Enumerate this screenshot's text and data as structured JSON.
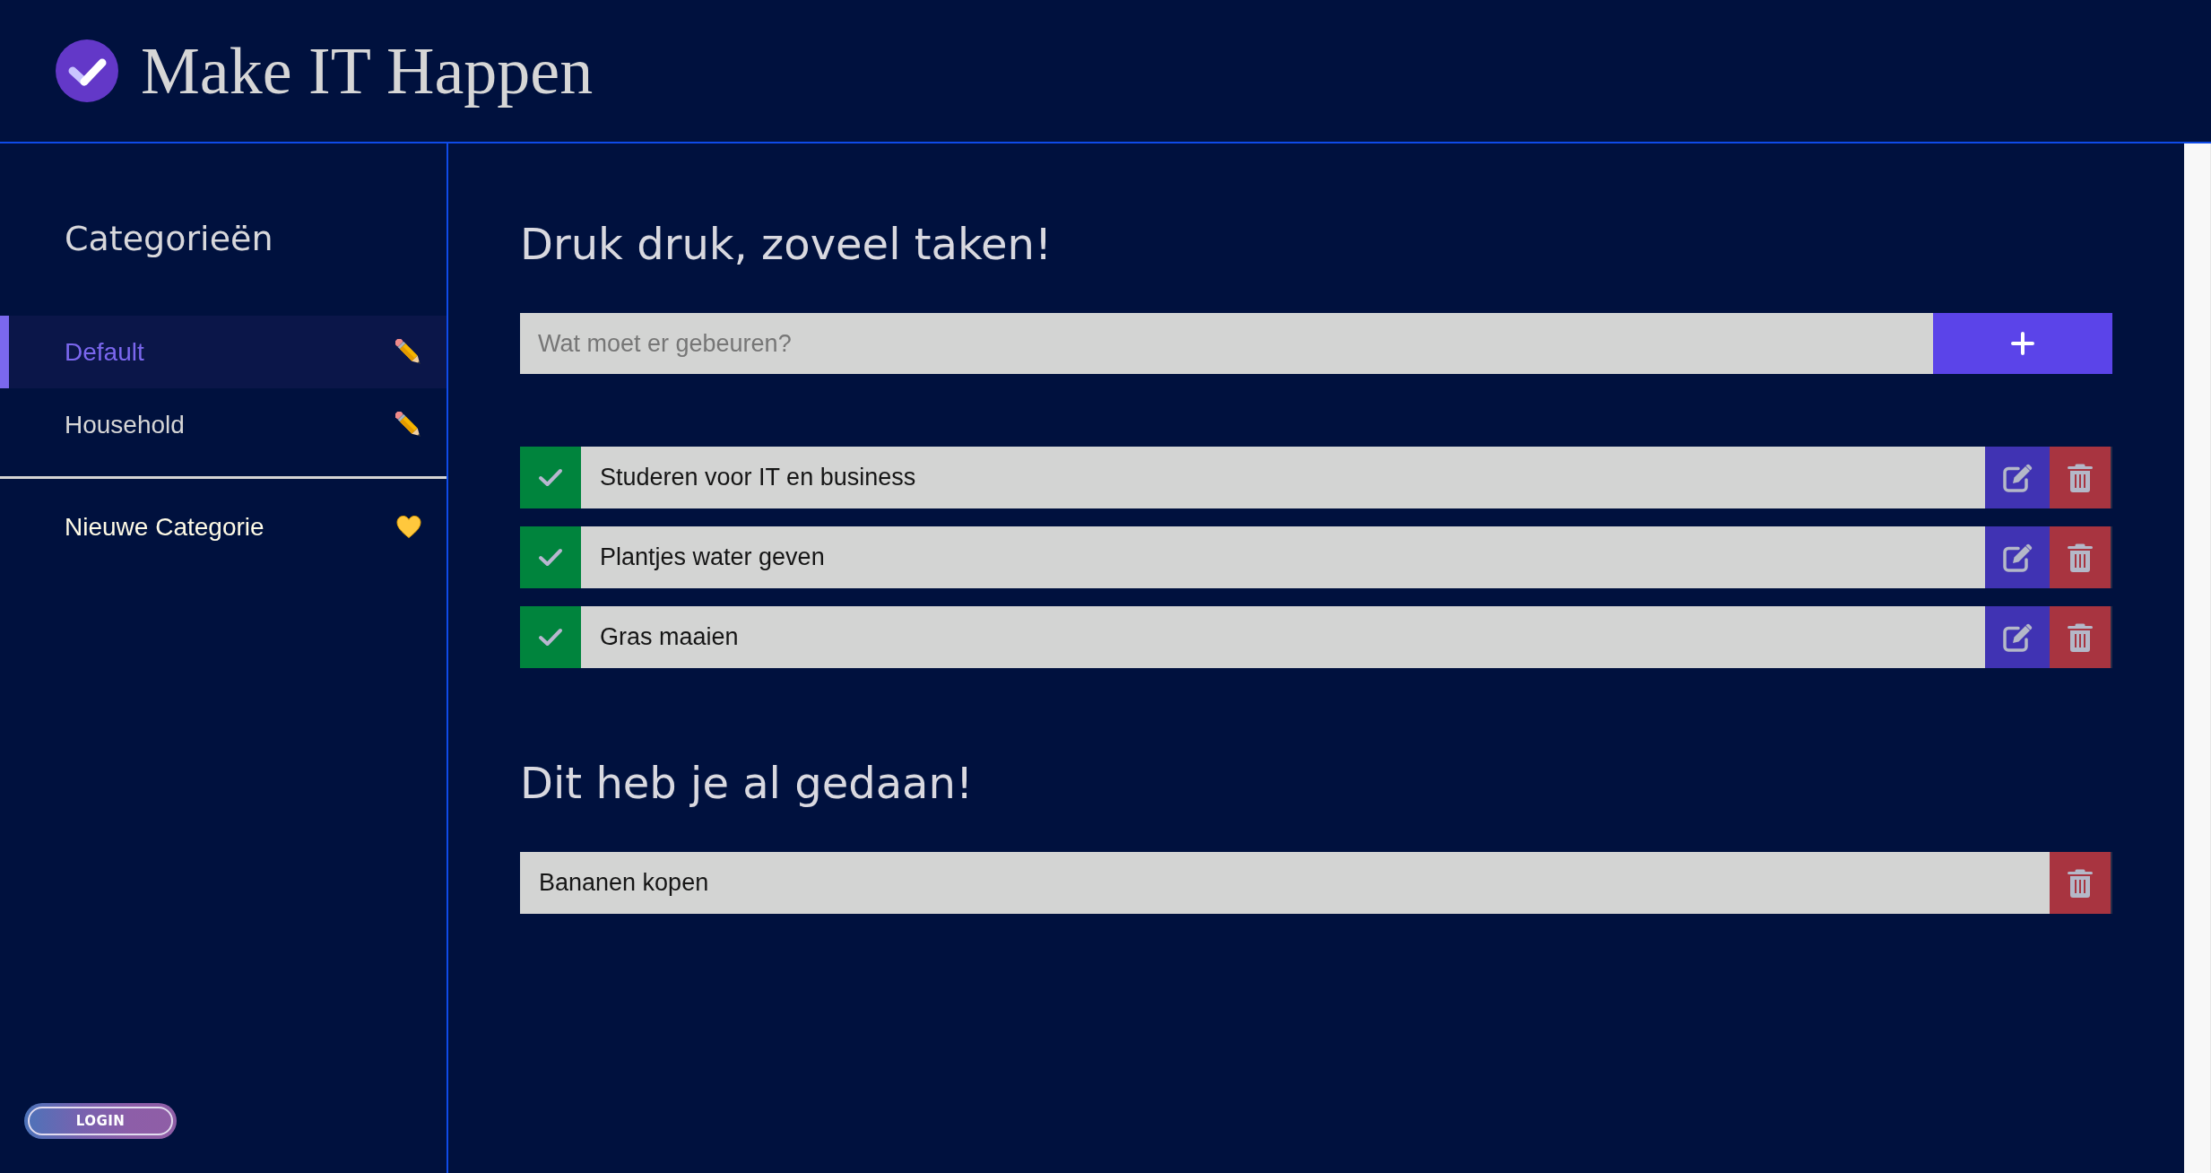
{
  "header": {
    "title": "Make IT Happen"
  },
  "sidebar": {
    "heading": "Categorieën",
    "categories": [
      {
        "label": "Default",
        "selected": true
      },
      {
        "label": "Household",
        "selected": false
      }
    ],
    "new_category": {
      "label": "Nieuwe Categorie"
    },
    "login_button": {
      "label": "LOGIN"
    }
  },
  "open_tasks": {
    "heading": "Druk druk, zoveel taken!",
    "new_task_field": {
      "placeholder": "Wat moet er gebeuren?"
    },
    "tasks": [
      {
        "label": "Studeren voor IT en business"
      },
      {
        "label": "Plantjes water geven"
      },
      {
        "label": "Gras maaien"
      }
    ]
  },
  "done_tasks": {
    "heading": "Dit heb je al gedaan!",
    "tasks": [
      {
        "label": "Bananen kopen"
      }
    ]
  }
}
